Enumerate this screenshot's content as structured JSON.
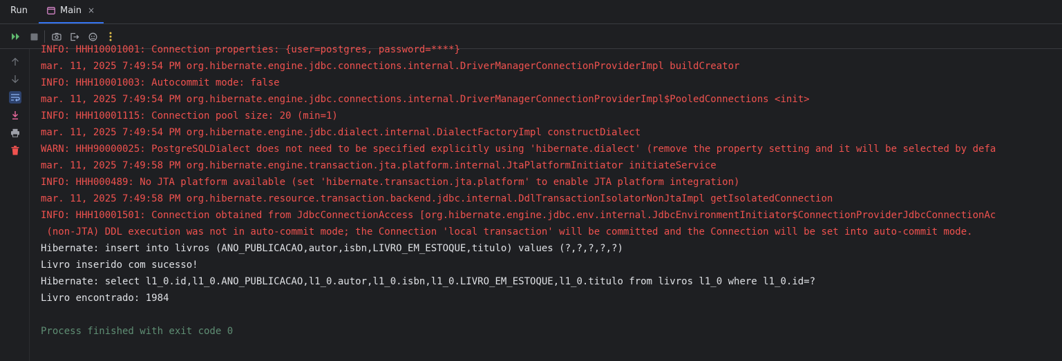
{
  "header": {
    "title": "Run",
    "tab": {
      "label": "Main",
      "close": "×"
    }
  },
  "console": {
    "lines": [
      {
        "type": "err",
        "text": "INFO: HHH10001001: Connection properties: {user=postgres, password=****}"
      },
      {
        "type": "err",
        "text": "mar. 11, 2025 7:49:54 PM org.hibernate.engine.jdbc.connections.internal.DriverManagerConnectionProviderImpl buildCreator"
      },
      {
        "type": "err",
        "text": "INFO: HHH10001003: Autocommit mode: false"
      },
      {
        "type": "err",
        "text": "mar. 11, 2025 7:49:54 PM org.hibernate.engine.jdbc.connections.internal.DriverManagerConnectionProviderImpl$PooledConnections <init>"
      },
      {
        "type": "err",
        "text": "INFO: HHH10001115: Connection pool size: 20 (min=1)"
      },
      {
        "type": "err",
        "text": "mar. 11, 2025 7:49:54 PM org.hibernate.engine.jdbc.dialect.internal.DialectFactoryImpl constructDialect"
      },
      {
        "type": "err",
        "text": "WARN: HHH90000025: PostgreSQLDialect does not need to be specified explicitly using 'hibernate.dialect' (remove the property setting and it will be selected by defa"
      },
      {
        "type": "err",
        "text": "mar. 11, 2025 7:49:58 PM org.hibernate.engine.transaction.jta.platform.internal.JtaPlatformInitiator initiateService"
      },
      {
        "type": "err",
        "text": "INFO: HHH000489: No JTA platform available (set 'hibernate.transaction.jta.platform' to enable JTA platform integration)"
      },
      {
        "type": "err",
        "text": "mar. 11, 2025 7:49:58 PM org.hibernate.resource.transaction.backend.jdbc.internal.DdlTransactionIsolatorNonJtaImpl getIsolatedConnection"
      },
      {
        "type": "err",
        "text": "INFO: HHH10001501: Connection obtained from JdbcConnectionAccess [org.hibernate.engine.jdbc.env.internal.JdbcEnvironmentInitiator$ConnectionProviderJdbcConnectionAc"
      },
      {
        "type": "err",
        "text": " (non-JTA) DDL execution was not in auto-commit mode; the Connection 'local transaction' will be committed and the Connection will be set into auto-commit mode."
      },
      {
        "type": "out",
        "text": "Hibernate: insert into livros (ANO_PUBLICACAO,autor,isbn,LIVRO_EM_ESTOQUE,titulo) values (?,?,?,?,?)"
      },
      {
        "type": "out",
        "text": "Livro inserido com sucesso!"
      },
      {
        "type": "out",
        "text": "Hibernate: select l1_0.id,l1_0.ANO_PUBLICACAO,l1_0.autor,l1_0.isbn,l1_0.LIVRO_EM_ESTOQUE,l1_0.titulo from livros l1_0 where l1_0.id=?"
      },
      {
        "type": "out",
        "text": "Livro encontrado: 1984"
      },
      {
        "type": "out",
        "text": ""
      },
      {
        "type": "sys",
        "text": "Process finished with exit code 0"
      }
    ]
  },
  "toolbar": {
    "icons": [
      "rerun-icon",
      "stop-icon",
      "screenshot-icon",
      "exit-icon",
      "debug-icon",
      "more-icon"
    ]
  },
  "gutter": {
    "icons": [
      "arrow-up-icon",
      "arrow-down-icon",
      "soft-wrap-icon",
      "scroll-to-end-icon",
      "print-icon",
      "clear-icon"
    ]
  },
  "colors": {
    "error": "#f0524f",
    "stdout": "#dfe1e5",
    "system": "#5f8e74",
    "accent": "#3574f0"
  }
}
